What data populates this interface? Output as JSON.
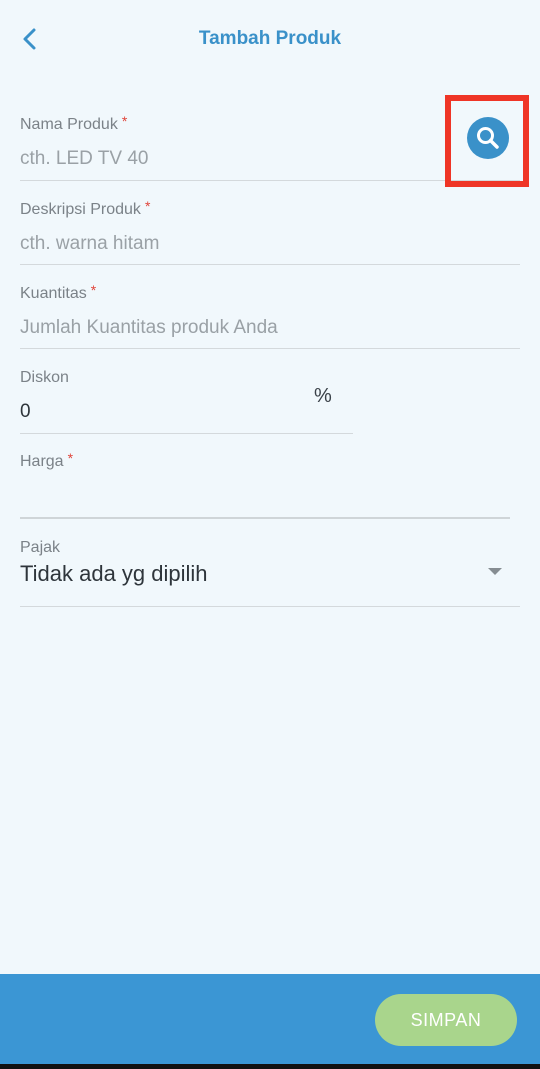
{
  "header": {
    "title": "Tambah Produk"
  },
  "form": {
    "nama_produk": {
      "label": "Nama Produk",
      "required_mark": "*",
      "placeholder": "cth. LED TV 40",
      "value": ""
    },
    "deskripsi_produk": {
      "label": "Deskripsi Produk",
      "required_mark": "*",
      "placeholder": "cth. warna hitam",
      "value": ""
    },
    "kuantitas": {
      "label": "Kuantitas",
      "required_mark": "*",
      "placeholder": "Jumlah Kuantitas produk Anda",
      "value": ""
    },
    "diskon": {
      "label": "Diskon",
      "value": "0",
      "suffix": "%"
    },
    "harga": {
      "label": "Harga",
      "required_mark": "*",
      "value": ""
    },
    "pajak": {
      "label": "Pajak",
      "selected": "Tidak ada yg dipilih"
    }
  },
  "footer": {
    "save_label": "SIMPAN"
  },
  "icons": {
    "back": "chevron-left-icon",
    "search": "search-icon",
    "dropdown": "caret-down-icon"
  },
  "colors": {
    "accent": "#3a91c9",
    "footer_bg": "#3b96d4",
    "save_button": "#a9d58c",
    "required": "#e0443a",
    "highlight": "#ef3526",
    "background": "#f1f8fc"
  }
}
